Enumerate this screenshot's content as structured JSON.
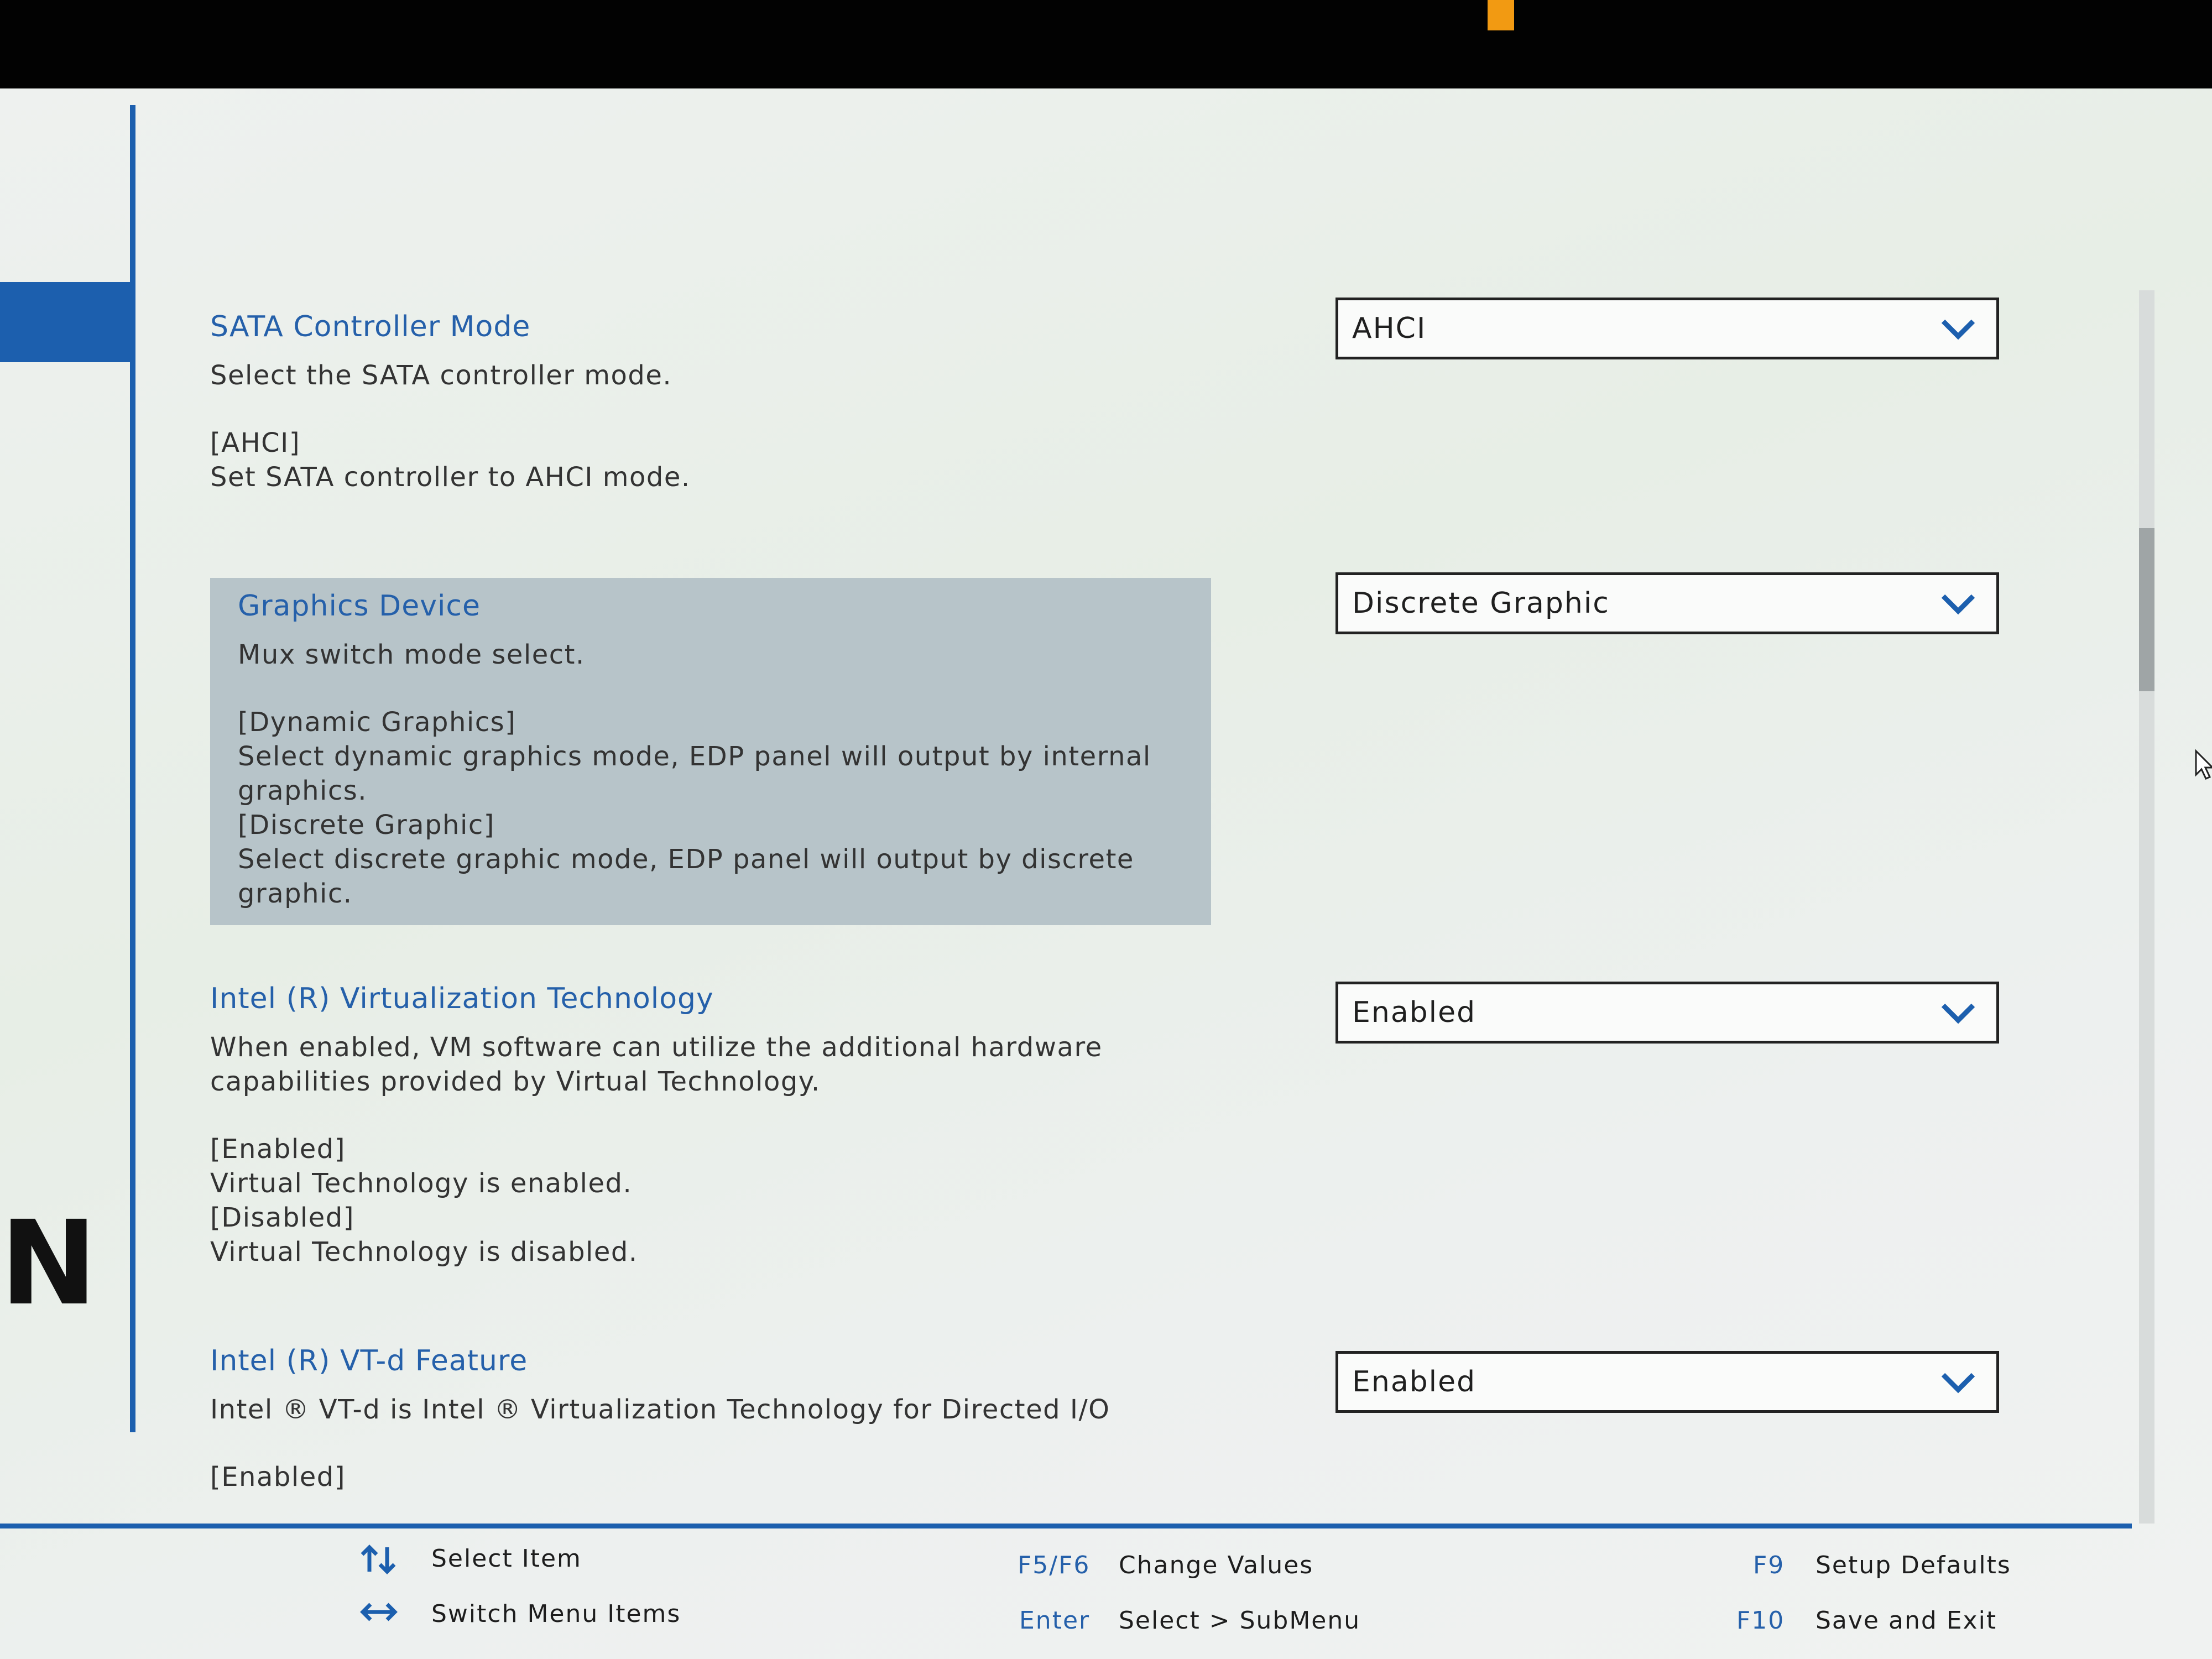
{
  "settings": [
    {
      "title": "SATA Controller Mode",
      "desc": "Select the SATA controller mode.",
      "detail": "[AHCI]\nSet SATA controller to AHCI mode.",
      "value": "AHCI"
    },
    {
      "title": "Graphics Device",
      "desc": "Mux switch mode select.",
      "detail": "[Dynamic Graphics]\nSelect dynamic graphics mode, EDP panel will output by internal\ngraphics.\n[Discrete Graphic]\nSelect discrete graphic mode, EDP panel will output by discrete\ngraphic.",
      "value": "Discrete Graphic"
    },
    {
      "title": "Intel (R) Virtualization Technology",
      "desc": "When enabled, VM software can utilize the additional hardware\ncapabilities provided by Virtual Technology.",
      "detail": "[Enabled]\nVirtual Technology is enabled.\n[Disabled]\nVirtual Technology is disabled.",
      "value": "Enabled"
    },
    {
      "title": "Intel (R) VT-d Feature",
      "desc": "Intel ® VT-d is Intel ® Virtualization Technology for Directed I/O",
      "detail": "[Enabled]",
      "value": "Enabled"
    }
  ],
  "logo_letter": "N",
  "footer": {
    "select_item": "Select Item",
    "switch_menu": "Switch Menu Items",
    "f5f6_key": "F5/F6",
    "f5f6_label": "Change Values",
    "enter_key": "Enter",
    "enter_label": "Select > SubMenu",
    "f9_key": "F9",
    "f9_label": "Setup Defaults",
    "f10_key": "F10",
    "f10_label": "Save and Exit"
  }
}
